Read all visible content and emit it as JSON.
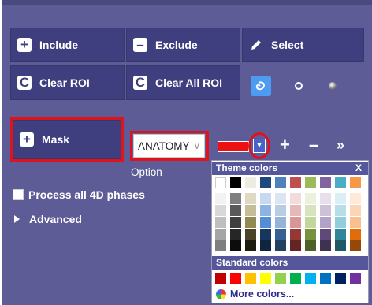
{
  "toolbar": {
    "include_label": "Include",
    "exclude_label": "Exclude",
    "select_label": "Select",
    "clear_roi_label": "Clear ROI",
    "clear_all_roi_label": "Clear All ROI",
    "mask_label": "Mask"
  },
  "roi_tools": [
    "freehand-icon",
    "circle-icon",
    "sphere-icon"
  ],
  "mask_settings": {
    "selected_mask": "ANATOMY",
    "option_label": "Option",
    "selected_color": "#ee1111",
    "add_label": "+",
    "remove_label": "–",
    "more_label": "»"
  },
  "options": {
    "process_4d_label": "Process all 4D phases",
    "process_4d_checked": false,
    "advanced_label": "Advanced"
  },
  "palette": {
    "theme_title": "Theme colors",
    "close_label": "X",
    "standard_title": "Standard colors",
    "more_colors_label": "More colors...",
    "theme_top": [
      "#ffffff",
      "#000000",
      "#eeece1",
      "#1f497d",
      "#4f81bd",
      "#c0504d",
      "#9bbb59",
      "#8064a2",
      "#4bacc6",
      "#f79646"
    ],
    "theme_columns": [
      [
        "#f2f2f2",
        "#d8d8d8",
        "#bfbfbf",
        "#a5a5a5",
        "#7f7f7f"
      ],
      [
        "#7f7f7f",
        "#595959",
        "#3f3f3f",
        "#262626",
        "#0c0c0c"
      ],
      [
        "#ddd9c3",
        "#c4bd97",
        "#938953",
        "#494429",
        "#1d1b10"
      ],
      [
        "#c6d9f0",
        "#8db3e2",
        "#548dd4",
        "#17365d",
        "#0f243e"
      ],
      [
        "#dbe5f1",
        "#b8cce4",
        "#95b3d7",
        "#366092",
        "#244061"
      ],
      [
        "#f2dcdb",
        "#e5b9b7",
        "#d99694",
        "#953734",
        "#632423"
      ],
      [
        "#ebf1dd",
        "#d7e3bc",
        "#c3d69b",
        "#76923c",
        "#4f6128"
      ],
      [
        "#e5e0ec",
        "#ccc1d9",
        "#b2a2c7",
        "#5f497a",
        "#3f3151"
      ],
      [
        "#dbeef3",
        "#b7dde8",
        "#92cddc",
        "#31859b",
        "#205867"
      ],
      [
        "#fdeada",
        "#fbd5b5",
        "#fac08f",
        "#e36c09",
        "#974806"
      ]
    ],
    "standard": [
      "#c00000",
      "#ff0000",
      "#ffc000",
      "#ffff00",
      "#92d050",
      "#00b050",
      "#00b0f0",
      "#0070c0",
      "#002060",
      "#7030a0"
    ]
  }
}
